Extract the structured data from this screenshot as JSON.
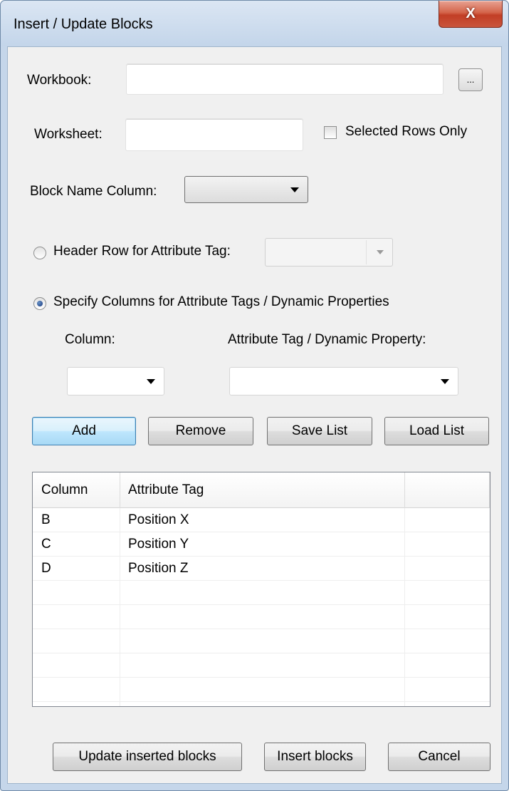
{
  "window": {
    "title": "Insert / Update Blocks",
    "close_glyph": "X"
  },
  "workbook": {
    "label": "Workbook:",
    "value": "",
    "browse_label": "..."
  },
  "worksheet": {
    "label": "Worksheet:",
    "value": "",
    "selected_rows_only_label": "Selected Rows Only",
    "selected_rows_only_checked": false
  },
  "block_name_column": {
    "label": "Block Name Column:",
    "value": ""
  },
  "header_row": {
    "label": "Header Row for Attribute Tag:",
    "selected": false,
    "value": ""
  },
  "specify_columns": {
    "label": "Specify Columns for Attribute Tags / Dynamic Properties",
    "selected": true,
    "column_label": "Column:",
    "column_value": "",
    "attribute_label": "Attribute Tag / Dynamic Property:",
    "attribute_value": ""
  },
  "list_buttons": {
    "add": "Add",
    "remove": "Remove",
    "save_list": "Save List",
    "load_list": "Load List"
  },
  "table": {
    "headers": [
      "Column",
      "Attribute Tag",
      ""
    ],
    "rows": [
      {
        "column": "B",
        "attribute_tag": "Position X"
      },
      {
        "column": "C",
        "attribute_tag": "Position Y"
      },
      {
        "column": "D",
        "attribute_tag": "Position Z"
      }
    ]
  },
  "footer_buttons": {
    "update_inserted_blocks": "Update inserted blocks",
    "insert_blocks": "Insert blocks",
    "cancel": "Cancel"
  },
  "colors": {
    "frame": "#c5d6ea",
    "dialog_bg": "#f0f0f0",
    "close_button": "#c9452b",
    "default_button_border": "#3c7fb1"
  },
  "icons": {
    "close": "close-icon",
    "dropdown": "chevron-down-icon",
    "browse": "ellipsis-icon"
  }
}
